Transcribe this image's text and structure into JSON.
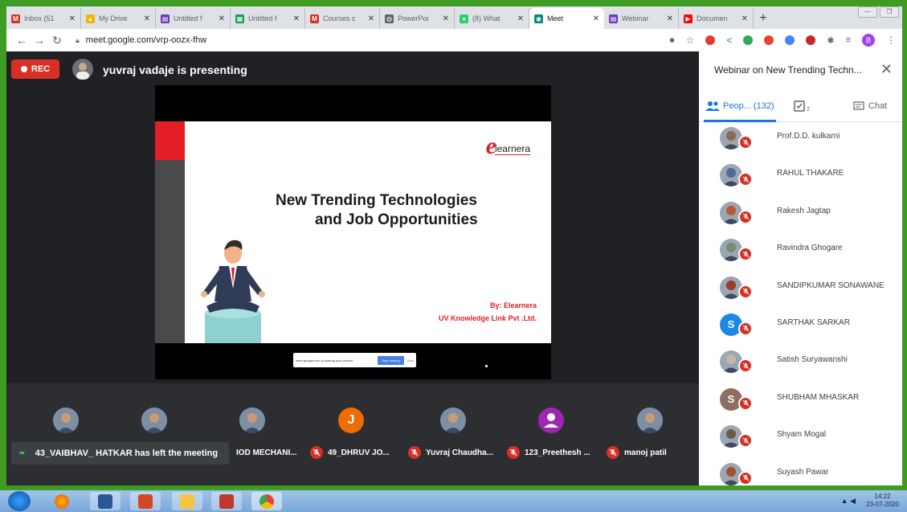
{
  "browser": {
    "tabs": [
      {
        "label": "Inbox (51",
        "icon": "gmail-icon",
        "color": "#d93025",
        "glyph": "M"
      },
      {
        "label": "My Drive",
        "icon": "drive-icon",
        "color": "#f4b400",
        "glyph": "▲"
      },
      {
        "label": "Untitled f",
        "icon": "forms-icon",
        "color": "#673ab7",
        "glyph": "▤"
      },
      {
        "label": "Untitled f",
        "icon": "sheets-icon",
        "color": "#0f9d58",
        "glyph": "▦"
      },
      {
        "label": "Courses c",
        "icon": "gmail-icon",
        "color": "#d93025",
        "glyph": "M"
      },
      {
        "label": "PowerPoi",
        "icon": "globe-icon",
        "color": "#5f6368",
        "glyph": "◍"
      },
      {
        "label": "(8) What",
        "icon": "whatsapp-icon",
        "color": "#25d366",
        "glyph": "●"
      },
      {
        "label": "Meet",
        "icon": "meet-icon",
        "color": "#00897b",
        "glyph": "◉",
        "active": true
      },
      {
        "label": "Webinar",
        "icon": "forms-icon",
        "color": "#673ab7",
        "glyph": "▤"
      },
      {
        "label": "Documen",
        "icon": "youtube-icon",
        "color": "#ff0000",
        "glyph": "▶"
      }
    ],
    "new_tab": "+",
    "url": "meet.google.com/vrp-oozx-fhw",
    "profile_initial": "B"
  },
  "meet": {
    "rec_label": "REC",
    "presenting_text": "yuvraj vadaje is presenting",
    "slide": {
      "logo_letter": "e",
      "logo_text": "learnera",
      "title_line1": "New Trending Technologies",
      "title_line2": "and Job Opportunities",
      "by_line1": "By: Elearnera",
      "by_line2": "UV Knowledge Link Pvt .Ltd."
    },
    "share_bar": {
      "text": "meet.google.com is sharing your screen.",
      "stop": "Stop sharing",
      "hide": "Hide"
    },
    "toast": "43_VAIBHAV_ HATKAR has left the meeting",
    "filmstrip": [
      {
        "name": "IOD MECHANI..."
      },
      {
        "name": "49_DHRUV JO..."
      },
      {
        "name": "Yuvraj Chaudha..."
      },
      {
        "name": "123_Preethesh ..."
      },
      {
        "name": "manoj patil"
      }
    ],
    "filmstrip_avatars": [
      {
        "initial": ""
      },
      {
        "initial": ""
      },
      {
        "initial": ""
      },
      {
        "initial": "J",
        "color": "#ef6c00"
      },
      {
        "initial": ""
      },
      {
        "initial": "",
        "color": "#9c27b0"
      },
      {
        "initial": ""
      }
    ]
  },
  "panel": {
    "title": "Webinar on New Trending Techn...",
    "tab_people": "Peop... (132)",
    "tab_activities_count": "2",
    "tab_chat": "Chat",
    "people": [
      {
        "name": "Prof.D.D. kulkarni"
      },
      {
        "name": "RAHUL THAKARE"
      },
      {
        "name": "Rakesh Jagtap"
      },
      {
        "name": "Ravindra Ghogare"
      },
      {
        "name": "SANDIPKUMAR SONAWANE"
      },
      {
        "name": "SARTHAK SARKAR",
        "initial": "S",
        "color": "#1e88e5"
      },
      {
        "name": "Satish Suryawanshi"
      },
      {
        "name": "SHUBHAM MHASKAR",
        "initial": "S",
        "color": "#8d6e63"
      },
      {
        "name": "Shyam Mogal"
      },
      {
        "name": "Suyash Pawar"
      }
    ]
  },
  "taskbar": {
    "time": "14:22",
    "date": "23-07-2020"
  }
}
